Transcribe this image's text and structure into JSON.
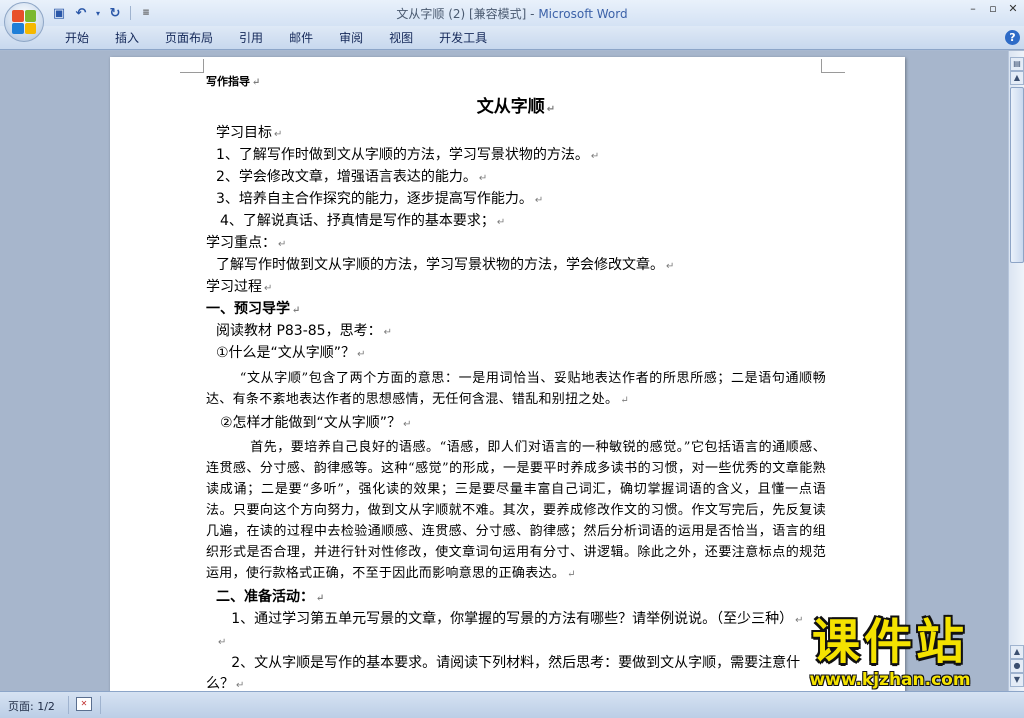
{
  "window": {
    "title_doc": "文从字顺 (2) [兼容模式] - ",
    "title_app": "Microsoft Word"
  },
  "ribbon": {
    "tabs": [
      "开始",
      "插入",
      "页面布局",
      "引用",
      "邮件",
      "审阅",
      "视图",
      "开发工具"
    ]
  },
  "document": {
    "section_label": "写作指导",
    "title": "文从字顺",
    "lines": {
      "goals_head": "学习目标",
      "goal1": "1、了解写作时做到文从字顺的方法，学习写景状物的方法。",
      "goal2": "2、学会修改文章，增强语言表达的能力。",
      "goal3": "3、培养自主合作探究的能力，逐步提高写作能力。",
      "goal4": "4、了解说真话、抒真情是写作的基本要求；",
      "focus_head": "学习重点：",
      "focus": "了解写作时做到文从字顺的方法，学习写景状物的方法，学会修改文章。",
      "process_head": "学习过程",
      "part1": "一、预习导学",
      "read": "阅读教材 P83-85，思考：",
      "q1": "①什么是“文从字顺”？",
      "a1": "“文从字顺”包含了两个方面的意思：一是用词恰当、妥贴地表达作者的所思所感；二是语句通顺畅达、有条不紊地表达作者的思想感情，无任何含混、错乱和别扭之处。",
      "q2": "②怎样才能做到“文从字顺”？",
      "a2": "首先，要培养自己良好的语感。“语感，即人们对语言的一种敏锐的感觉。”它包括语言的通顺感、连贯感、分寸感、韵律感等。这种“感觉”的形成，一是要平时养成多读书的习惯，对一些优秀的文章能熟读成诵；二是要“多听”，强化读的效果；三是要尽量丰富自己词汇，确切掌握词语的含义，且懂一点语法。只要向这个方向努力，做到文从字顺就不难。其次，要养成修改作文的习惯。作文写完后，先反复读几遍，在读的过程中去检验通顺感、连贯感、分寸感、韵律感；然后分析词语的运用是否恰当，语言的组织形式是否合理，并进行针对性修改，使文章词句运用有分寸、讲逻辑。除此之外，还要注意标点的规范运用，使行款格式正确，不至于因此而影响意思的正确表达。",
      "part2": "二、准备活动：",
      "task1": "1、通过学习第五单元写景的文章，你掌握的写景的方法有哪些？请举例说说。（至少三种）",
      "task2": "2、文从字顺是写作的基本要求。请阅读下列材料，然后思考：要做到文从字顺，需要注意什么？"
    },
    "para_mark": "↵"
  },
  "status": {
    "page": "页面: 1/2"
  },
  "watermark": {
    "big": "课件站",
    "url": "www.kjzhan.com"
  }
}
